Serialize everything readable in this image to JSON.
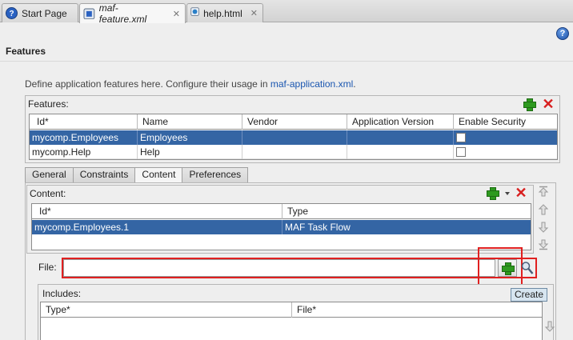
{
  "tabs": {
    "start_page": "Start Page",
    "maf_feature": "maf-feature.xml",
    "help": "help.html"
  },
  "page_title": "Features",
  "intro": {
    "text": "Define application features here. Configure their usage in ",
    "link": "maf-application.xml",
    "suffix": "."
  },
  "features": {
    "label": "Features:",
    "columns": [
      "Id*",
      "Name",
      "Vendor",
      "Application Version",
      "Enable Security"
    ],
    "rows": [
      {
        "id": "mycomp.Employees",
        "name": "Employees",
        "vendor": "",
        "app_version": "",
        "security": false,
        "selected": true
      },
      {
        "id": "mycomp.Help",
        "name": "Help",
        "vendor": "",
        "app_version": "",
        "security": false,
        "selected": false
      }
    ]
  },
  "feature_tabs": [
    "General",
    "Constraints",
    "Content",
    "Preferences"
  ],
  "content": {
    "label": "Content:",
    "columns": [
      "Id*",
      "Type"
    ],
    "rows": [
      {
        "id": "mycomp.Employees.1",
        "type": "MAF Task Flow",
        "selected": true
      }
    ]
  },
  "file": {
    "label": "File:",
    "value": "",
    "tooltip": "Create"
  },
  "includes": {
    "label": "Includes:",
    "columns": [
      "Type*",
      "File*"
    ]
  },
  "colors": {
    "selection": "#3465a4",
    "link": "#1a56b0",
    "highlight": "#e02020",
    "add_green": "#2e9a1f",
    "delete_red": "#d81f1f"
  }
}
